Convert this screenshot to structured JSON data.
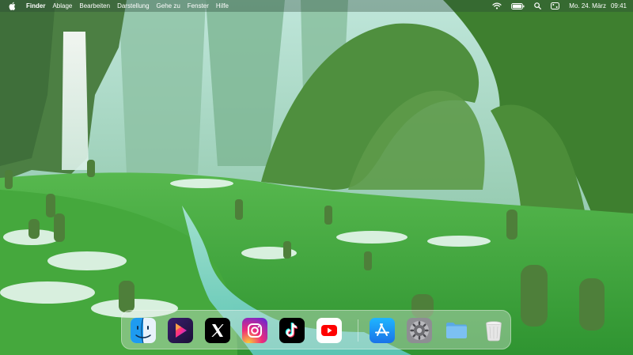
{
  "menubar": {
    "apple_icon": "apple-logo-icon",
    "items": [
      {
        "label": "Finder",
        "bold": true
      },
      {
        "label": "Ablage"
      },
      {
        "label": "Bearbeiten"
      },
      {
        "label": "Darstellung"
      },
      {
        "label": "Gehe zu"
      },
      {
        "label": "Fenster"
      },
      {
        "label": "Hilfe"
      }
    ],
    "status_icons": [
      "wifi-icon",
      "battery-icon",
      "spotlight-search-icon",
      "control-center-icon"
    ],
    "date": "Mo. 24. März",
    "time": "09:41"
  },
  "dock": {
    "apps": [
      {
        "name": "Finder",
        "icon": "finder-icon"
      },
      {
        "name": "Infuse",
        "icon": "infuse-icon"
      },
      {
        "name": "X",
        "icon": "x-icon"
      },
      {
        "name": "Instagram",
        "icon": "instagram-icon"
      },
      {
        "name": "TikTok",
        "icon": "tiktok-icon"
      },
      {
        "name": "YouTube",
        "icon": "youtube-icon"
      },
      {
        "name": "App Store",
        "icon": "app-store-icon"
      },
      {
        "name": "Systemeinstellungen",
        "icon": "settings-gear-icon"
      },
      {
        "name": "Ordner",
        "icon": "folder-icon"
      },
      {
        "name": "Papierkorb",
        "icon": "trash-icon"
      }
    ]
  },
  "colors": {
    "menubar_text": "#ffffff",
    "youtube_red": "#ff0000",
    "instagram_gradient": [
      "#f9ce34",
      "#ee2a7b",
      "#6228d7"
    ],
    "app_store_blue": "#1a8cff",
    "grass_green": "#3fa642"
  }
}
